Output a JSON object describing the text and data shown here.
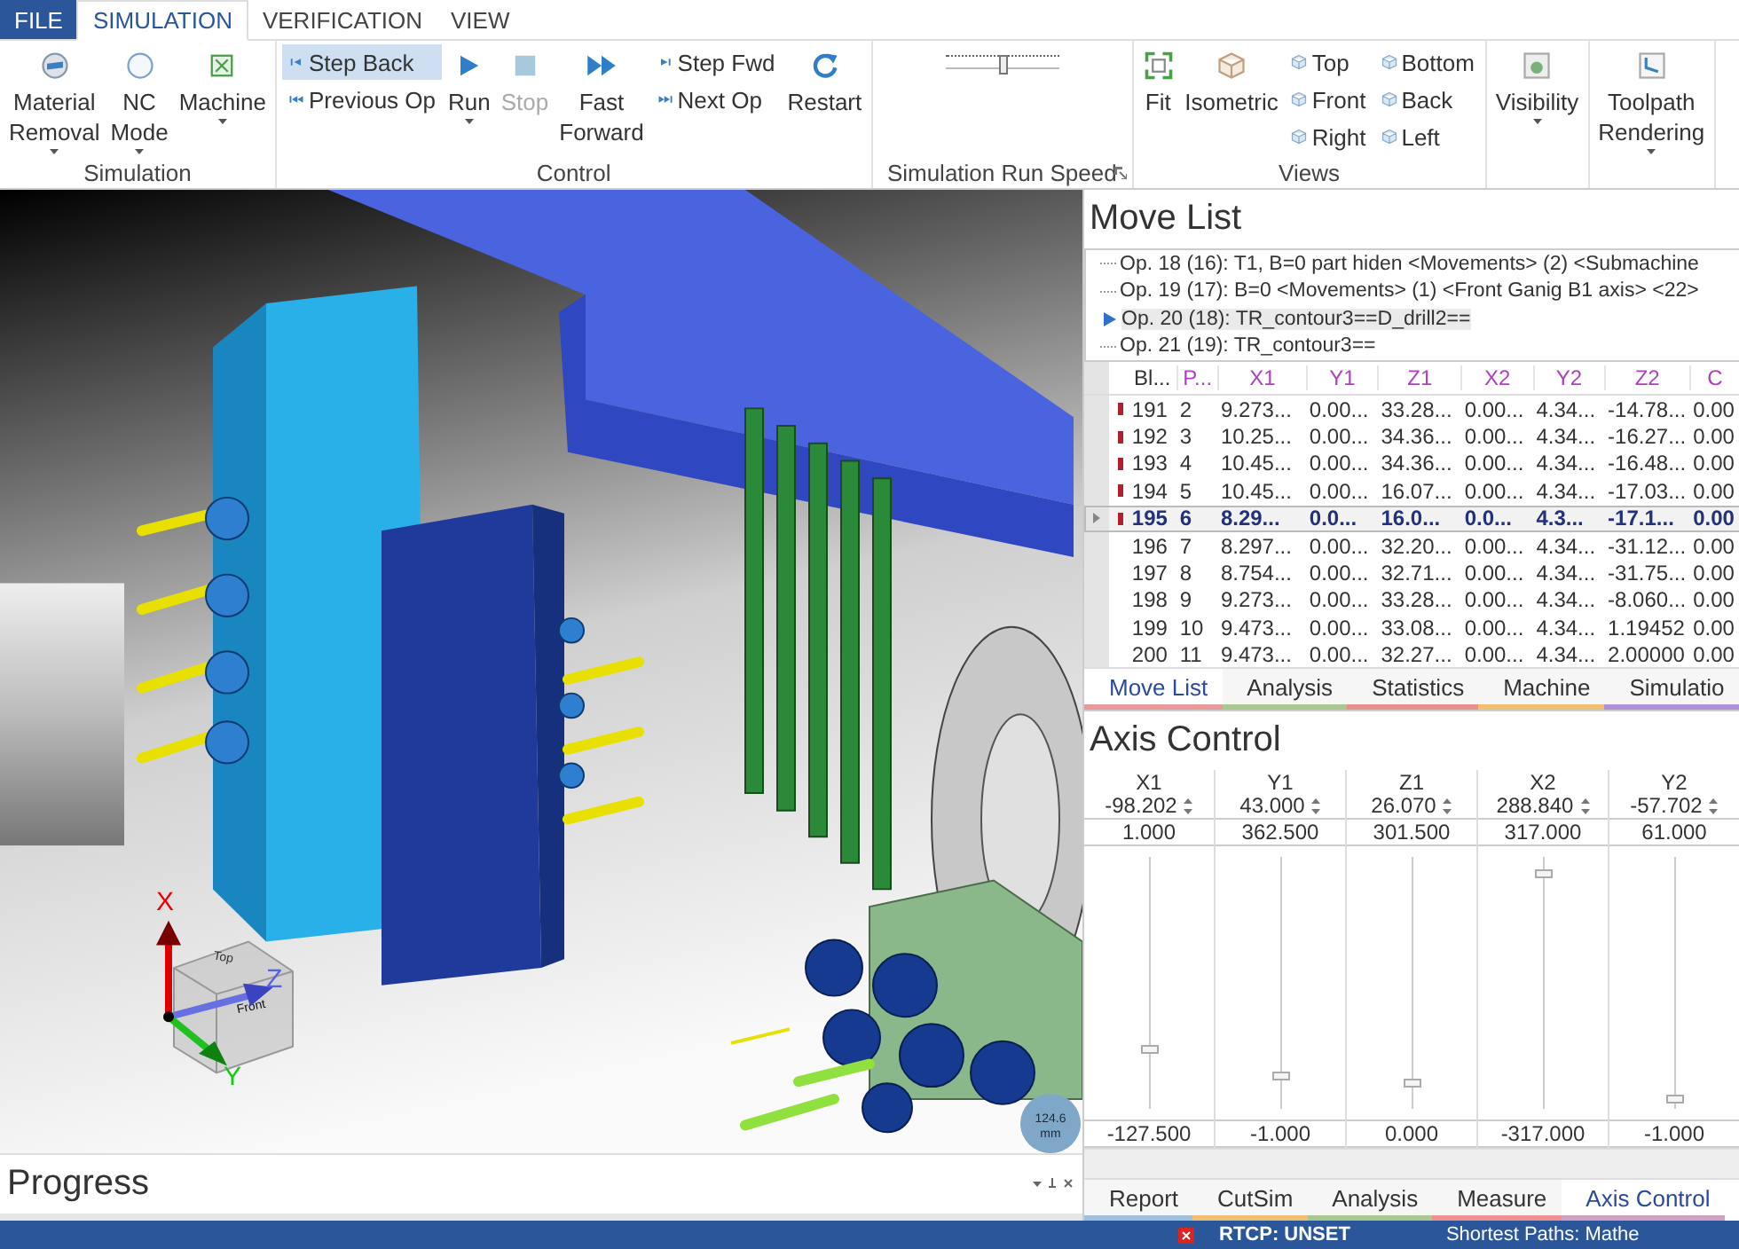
{
  "ribbon": {
    "tabs": [
      {
        "label": "FILE",
        "kind": "file",
        "selected": false
      },
      {
        "label": "SIMULATION",
        "kind": "tab",
        "selected": true
      },
      {
        "label": "VERIFICATION",
        "kind": "tab",
        "selected": false
      },
      {
        "label": "VIEW",
        "kind": "tab",
        "selected": false
      }
    ],
    "groups": [
      {
        "label": "Simulation",
        "kind": "buttons",
        "columns": [
          {
            "kind": "large",
            "label": "Material Removal",
            "dropdown": true
          },
          {
            "kind": "large",
            "label": "NC Mode",
            "dropdown": true
          },
          {
            "kind": "large",
            "label": "Machine",
            "dropdown": true
          }
        ]
      },
      {
        "label": "Control",
        "kind": "buttons",
        "columns": [
          {
            "kind": "stack",
            "items": [
              {
                "label": "Step Back",
                "active": true,
                "disabled": false
              },
              {
                "label": "Previous Op",
                "active": false,
                "disabled": false
              }
            ]
          },
          {
            "kind": "large",
            "label": "Run",
            "dropdown": true,
            "disabled": false
          },
          {
            "kind": "large",
            "label": "Stop",
            "dropdown": false,
            "disabled": true
          },
          {
            "kind": "large",
            "label": "Fast Forward",
            "dropdown": false,
            "disabled": false
          },
          {
            "kind": "stack",
            "items": [
              {
                "label": "Step Fwd",
                "active": false,
                "disabled": false
              },
              {
                "label": "Next Op",
                "active": false,
                "disabled": false
              }
            ]
          },
          {
            "kind": "large",
            "label": "Restart",
            "dropdown": false,
            "disabled": false
          }
        ]
      },
      {
        "label": "Simulation Run Speed",
        "kind": "slider",
        "level": 0.5,
        "launcher": true
      },
      {
        "label": "Views",
        "kind": "buttons",
        "columns": [
          {
            "kind": "large",
            "label": "Fit",
            "dropdown": false
          },
          {
            "kind": "large",
            "label": "Isometric",
            "dropdown": false
          },
          {
            "kind": "stack",
            "items": [
              {
                "label": "Top",
                "active": false,
                "disabled": false
              },
              {
                "label": "Front",
                "active": false,
                "disabled": false
              },
              {
                "label": "Right",
                "active": false,
                "disabled": false
              }
            ]
          },
          {
            "kind": "stack",
            "items": [
              {
                "label": "Bottom",
                "active": false,
                "disabled": false
              },
              {
                "label": "Back",
                "active": false,
                "disabled": false
              },
              {
                "label": "Left",
                "active": false,
                "disabled": false
              }
            ]
          }
        ]
      },
      {
        "kind": "buttons",
        "columns": [
          {
            "kind": "large",
            "label": "Visibility",
            "dropdown": true
          }
        ]
      },
      {
        "kind": "buttons",
        "columns": [
          {
            "kind": "large",
            "label": "Toolpath Rendering",
            "dropdown": true
          }
        ]
      }
    ]
  },
  "viewport": {
    "axes": {
      "x": "X",
      "y": "Y",
      "z": "Z"
    },
    "cube_faces": [
      "Top",
      "Front"
    ],
    "scale": {
      "value": "124.6",
      "unit": "mm"
    }
  },
  "progress": {
    "title": "Progress"
  },
  "move_list": {
    "title": "Move List",
    "operations": [
      {
        "label": "Op. 18 (16): T1, B=0 part hiden <Movements> (2) <Submachine",
        "selected": false
      },
      {
        "label": "Op. 19 (17): B=0 <Movements> (1) <Front Ganig B1 axis> <22>",
        "selected": false
      },
      {
        "label": "Op. 20 (18): TR_contour3==D_drill2==",
        "selected": true
      },
      {
        "label": "Op. 21 (19): TR_contour3==",
        "selected": false
      }
    ],
    "columns": [
      "Bl...",
      "P...",
      "X1",
      "Y1",
      "Z1",
      "X2",
      "Y2",
      "Z2",
      "C"
    ],
    "rows": [
      {
        "cells": [
          "191",
          "2",
          "9.273...",
          "0.00...",
          "33.28...",
          "0.00...",
          "4.34...",
          "-14.78...",
          "0.00"
        ],
        "flag": true,
        "selected": false
      },
      {
        "cells": [
          "192",
          "3",
          "10.25...",
          "0.00...",
          "34.36...",
          "0.00...",
          "4.34...",
          "-16.27...",
          "0.00"
        ],
        "flag": true,
        "selected": false
      },
      {
        "cells": [
          "193",
          "4",
          "10.45...",
          "0.00...",
          "34.36...",
          "0.00...",
          "4.34...",
          "-16.48...",
          "0.00"
        ],
        "flag": true,
        "selected": false
      },
      {
        "cells": [
          "194",
          "5",
          "10.45...",
          "0.00...",
          "16.07...",
          "0.00...",
          "4.34...",
          "-17.03...",
          "0.00"
        ],
        "flag": true,
        "selected": false
      },
      {
        "cells": [
          "195",
          "6",
          "8.29...",
          "0.0...",
          "16.0...",
          "0.0...",
          "4.3...",
          "-17.1...",
          "0.00"
        ],
        "flag": true,
        "selected": true
      },
      {
        "cells": [
          "196",
          "7",
          "8.297...",
          "0.00...",
          "32.20...",
          "0.00...",
          "4.34...",
          "-31.12...",
          "0.00"
        ],
        "flag": false,
        "selected": false
      },
      {
        "cells": [
          "197",
          "8",
          "8.754...",
          "0.00...",
          "32.71...",
          "0.00...",
          "4.34...",
          "-31.75...",
          "0.00"
        ],
        "flag": false,
        "selected": false
      },
      {
        "cells": [
          "198",
          "9",
          "9.273...",
          "0.00...",
          "33.28...",
          "0.00...",
          "4.34...",
          "-8.060...",
          "0.00"
        ],
        "flag": false,
        "selected": false
      },
      {
        "cells": [
          "199",
          "10",
          "9.473...",
          "0.00...",
          "33.08...",
          "0.00...",
          "4.34...",
          "1.19452",
          "0.00"
        ],
        "flag": false,
        "selected": false
      },
      {
        "cells": [
          "200",
          "11",
          "9.473...",
          "0.00...",
          "32.27...",
          "0.00...",
          "4.34...",
          "2.00000",
          "0.00"
        ],
        "flag": false,
        "selected": false
      }
    ],
    "tabs": [
      {
        "label": "Move List",
        "color": "#e89a9a",
        "selected": true
      },
      {
        "label": "Analysis",
        "color": "#a8c890",
        "selected": false
      },
      {
        "label": "Statistics",
        "color": "#e89090",
        "selected": false
      },
      {
        "label": "Machine",
        "color": "#f0c070",
        "selected": false
      },
      {
        "label": "Simulatio",
        "color": "#b090d8",
        "selected": false
      }
    ]
  },
  "axis_control": {
    "title": "Axis Control",
    "axes": [
      {
        "name": "X1",
        "value": "-98.202",
        "max": "1.000",
        "min": "-127.500",
        "level": 0.23
      },
      {
        "name": "Y1",
        "value": "43.000",
        "max": "362.500",
        "min": "-1.000",
        "level": 0.12
      },
      {
        "name": "Z1",
        "value": "26.070",
        "max": "301.500",
        "min": "0.000",
        "level": 0.09
      },
      {
        "name": "X2",
        "value": "288.840",
        "max": "317.000",
        "min": "-317.000",
        "level": 0.95
      },
      {
        "name": "Y2",
        "value": "-57.702",
        "max": "61.000",
        "min": "-1.000",
        "level": 0.02
      }
    ],
    "tabs": [
      {
        "label": "Report",
        "color": "#a0c0e0",
        "selected": false
      },
      {
        "label": "CutSim",
        "color": "#f0c070",
        "selected": false
      },
      {
        "label": "Analysis",
        "color": "#a8c890",
        "selected": false
      },
      {
        "label": "Measure",
        "color": "#f09090",
        "selected": false
      },
      {
        "label": "Axis Control",
        "color": "#d0a0c0",
        "selected": true
      }
    ]
  },
  "status_bar": {
    "error": true,
    "items": [
      "RTCP: UNSET",
      "Shortest Paths: Mathe"
    ]
  }
}
